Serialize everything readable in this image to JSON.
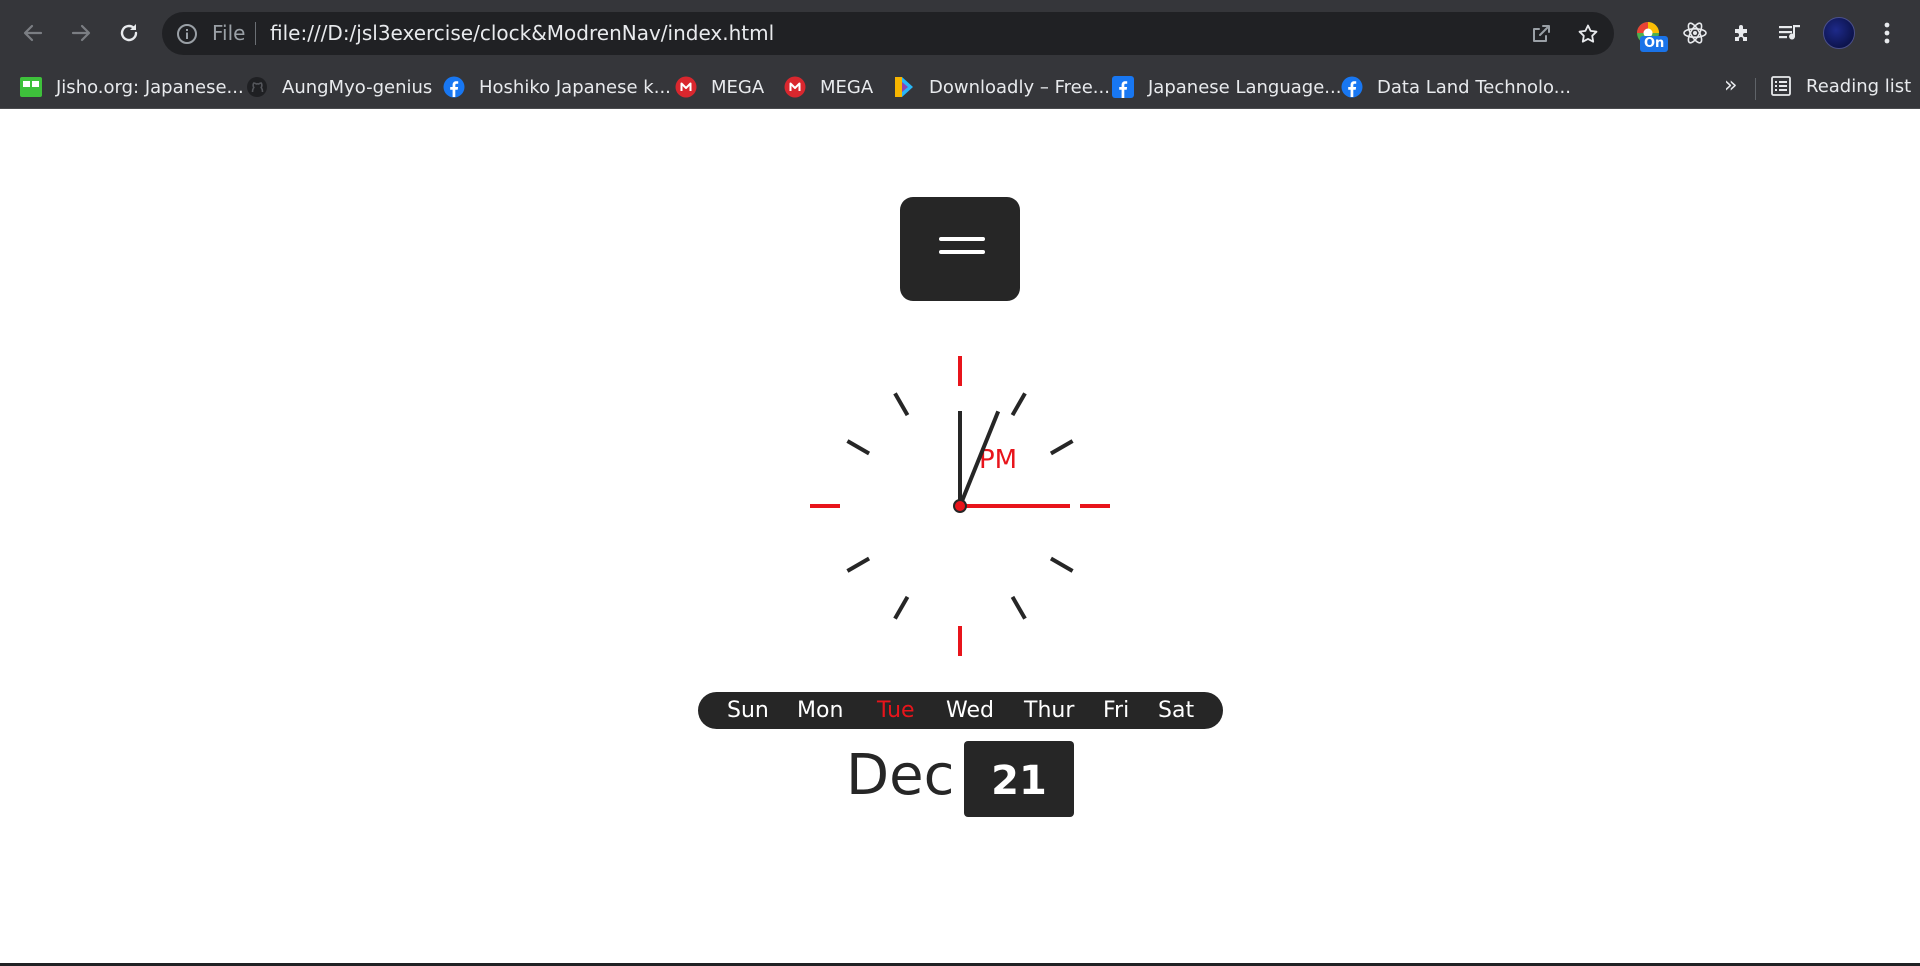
{
  "browser": {
    "url_scheme": "File",
    "url": "file:///D:/jsl3exercise/clock&ModrenNav/index.html",
    "extension_badge": "On",
    "icons": {
      "back": "arrow-left-icon",
      "forward": "arrow-right-icon",
      "reload": "reload-icon",
      "info": "info-icon",
      "share": "share-icon",
      "bookmark_star": "star-icon",
      "extensions": "puzzle-icon",
      "media": "media-queue-icon",
      "menu": "kebab-menu-icon"
    }
  },
  "bookmarks": {
    "items": [
      {
        "label": "Jisho.org: Japanese...",
        "icon": "jisho-icon"
      },
      {
        "label": "AungMyo-genius",
        "icon": "github-icon"
      },
      {
        "label": "Hoshiko Japanese k...",
        "icon": "facebook-icon"
      },
      {
        "label": "MEGA",
        "icon": "mega-icon"
      },
      {
        "label": "MEGA",
        "icon": "mega-icon"
      },
      {
        "label": "Downloadly – Free...",
        "icon": "downloadly-icon"
      },
      {
        "label": "Japanese Language...",
        "icon": "facebook-icon"
      },
      {
        "label": "Data Land Technolo...",
        "icon": "facebook-icon"
      }
    ],
    "more": "»",
    "reading_list": "Reading list"
  },
  "clock": {
    "meridiem": "PM",
    "hour_angle_deg": 22,
    "minute_angle_deg": 0,
    "second_angle_deg": 90,
    "colors": {
      "accent": "#e8141b",
      "dark": "#262626"
    }
  },
  "days": {
    "items": [
      "Sun",
      "Mon",
      "Tue",
      "Wed",
      "Thur",
      "Fri",
      "Sat"
    ],
    "active_index": 2
  },
  "date": {
    "month": "Dec",
    "day": "21"
  },
  "colors": {
    "chrome_bg": "#35363a",
    "omnibox_bg": "#202124",
    "accent_red": "#e8141b",
    "panel_dark": "#262626"
  }
}
